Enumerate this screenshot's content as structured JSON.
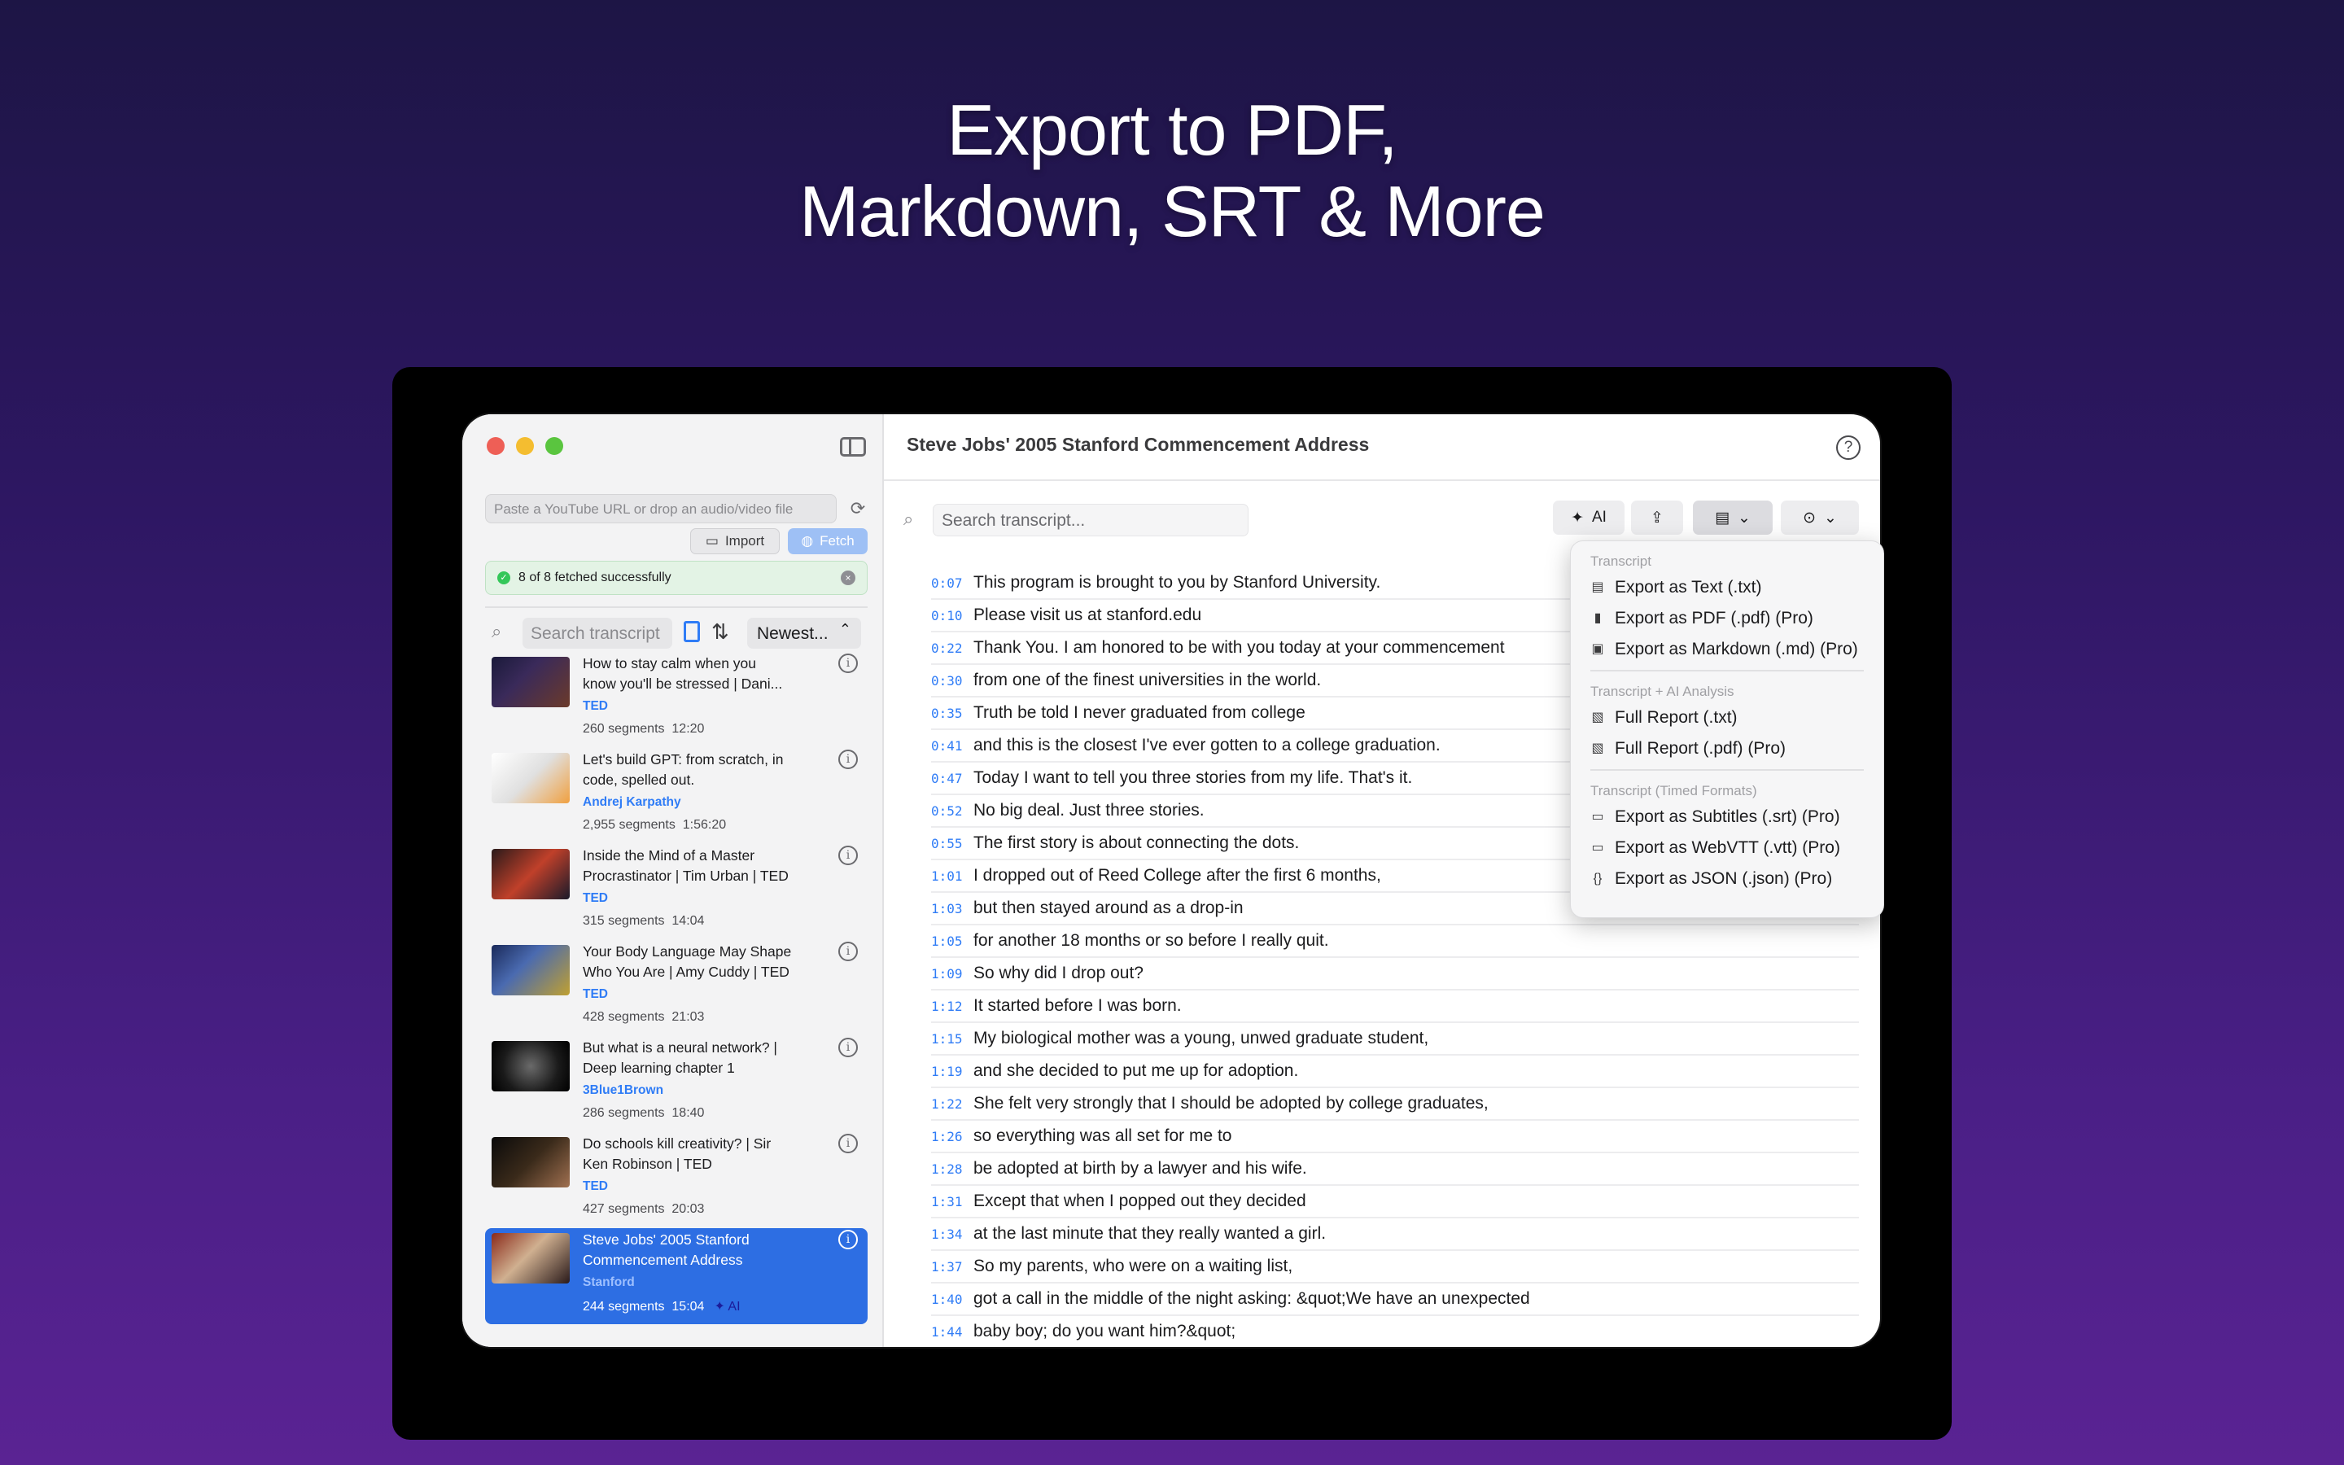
{
  "headline": {
    "line1": "Export to PDF,",
    "line2": "Markdown, SRT & More"
  },
  "sidebar": {
    "url_placeholder": "Paste a YouTube URL or drop an audio/video file",
    "import_label": "Import",
    "fetch_label": "Fetch",
    "status_text": "8 of 8 fetched successfully",
    "search_placeholder": "Search transcript",
    "sort_value": "Newest...",
    "videos": [
      {
        "title": "How to stay calm when you\nknow you'll be stressed | Dani...",
        "channel": "TED",
        "segments": "260 segments",
        "duration": "12:20"
      },
      {
        "title": "Let's build GPT: from scratch, in\ncode, spelled out.",
        "channel": "Andrej Karpathy",
        "segments": "2,955 segments",
        "duration": "1:56:20"
      },
      {
        "title": "Inside the Mind of a Master\nProcrastinator | Tim Urban | TED",
        "channel": "TED",
        "segments": "315 segments",
        "duration": "14:04"
      },
      {
        "title": "Your Body Language May Shape\nWho You Are | Amy Cuddy | TED",
        "channel": "TED",
        "segments": "428 segments",
        "duration": "21:03"
      },
      {
        "title": "But what is a neural network? |\nDeep learning chapter 1",
        "channel": "3Blue1Brown",
        "segments": "286 segments",
        "duration": "18:40"
      },
      {
        "title": "Do schools kill creativity? | Sir\nKen Robinson | TED",
        "channel": "TED",
        "segments": "427 segments",
        "duration": "20:03"
      },
      {
        "title": "Steve Jobs' 2005 Stanford\nCommencement Address",
        "channel": "Stanford",
        "segments": "244 segments",
        "duration": "15:04",
        "badge": "AI"
      }
    ]
  },
  "main": {
    "title": "Steve Jobs' 2005 Stanford Commencement Address",
    "search_placeholder": "Search transcript...",
    "ai_label": "AI",
    "segments": [
      {
        "t": "0:07",
        "text": "This program is brought to you by Stanford University."
      },
      {
        "t": "0:10",
        "text": "Please visit us at stanford.edu"
      },
      {
        "t": "0:22",
        "text": "Thank You. I am honored to be with you today at your commencement"
      },
      {
        "t": "0:30",
        "text": "from one of the finest universities in the world."
      },
      {
        "t": "0:35",
        "text": "Truth be told I never graduated from college"
      },
      {
        "t": "0:41",
        "text": "and this is the closest I've ever gotten to a college graduation."
      },
      {
        "t": "0:47",
        "text": "Today I want to tell you three stories from my life. That's it."
      },
      {
        "t": "0:52",
        "text": "No big deal. Just three stories."
      },
      {
        "t": "0:55",
        "text": "The first story is about connecting the dots."
      },
      {
        "t": "1:01",
        "text": "I dropped out of Reed College after the first 6 months,"
      },
      {
        "t": "1:03",
        "text": "but then stayed around as a drop-in"
      },
      {
        "t": "1:05",
        "text": "for another 18 months or so before I really quit."
      },
      {
        "t": "1:09",
        "text": "So why did I drop out?"
      },
      {
        "t": "1:12",
        "text": "It started before I was born."
      },
      {
        "t": "1:15",
        "text": "My biological mother was a young, unwed graduate student,"
      },
      {
        "t": "1:19",
        "text": "and she decided to put me up for adoption."
      },
      {
        "t": "1:22",
        "text": "She felt very strongly that I should be adopted by college graduates,"
      },
      {
        "t": "1:26",
        "text": "so everything was all set for me to"
      },
      {
        "t": "1:28",
        "text": "be adopted at birth by a lawyer and his wife."
      },
      {
        "t": "1:31",
        "text": "Except that when I popped out they decided"
      },
      {
        "t": "1:34",
        "text": "at the last minute that they really wanted a girl."
      },
      {
        "t": "1:37",
        "text": "So my parents, who were on a waiting list,"
      },
      {
        "t": "1:40",
        "text": "got a call in the middle of the night asking: &quot;We have an unexpected"
      },
      {
        "t": "1:44",
        "text": "baby boy; do you want him?&quot;"
      }
    ]
  },
  "export_menu": {
    "sections": [
      {
        "header": "Transcript",
        "items": [
          {
            "icon": "doc-icon",
            "label": "Export as Text (.txt)"
          },
          {
            "icon": "pdf-icon",
            "label": "Export as PDF (.pdf) (Pro)"
          },
          {
            "icon": "markdown-icon",
            "label": "Export as Markdown (.md) (Pro)"
          }
        ]
      },
      {
        "header": "Transcript + AI Analysis",
        "items": [
          {
            "icon": "report-icon",
            "label": "Full Report (.txt)"
          },
          {
            "icon": "report-icon",
            "label": "Full Report (.pdf) (Pro)"
          }
        ]
      },
      {
        "header": "Transcript (Timed Formats)",
        "items": [
          {
            "icon": "subtitle-icon",
            "label": "Export as Subtitles (.srt) (Pro)"
          },
          {
            "icon": "subtitle-icon",
            "label": "Export as WebVTT (.vtt) (Pro)"
          },
          {
            "icon": "json-icon",
            "label": "Export as JSON (.json) (Pro)"
          }
        ]
      }
    ]
  },
  "colors": {
    "accent": "#2f7cf6",
    "selected_row": "#2d6ee3",
    "status_bg": "#e3f3e5"
  }
}
